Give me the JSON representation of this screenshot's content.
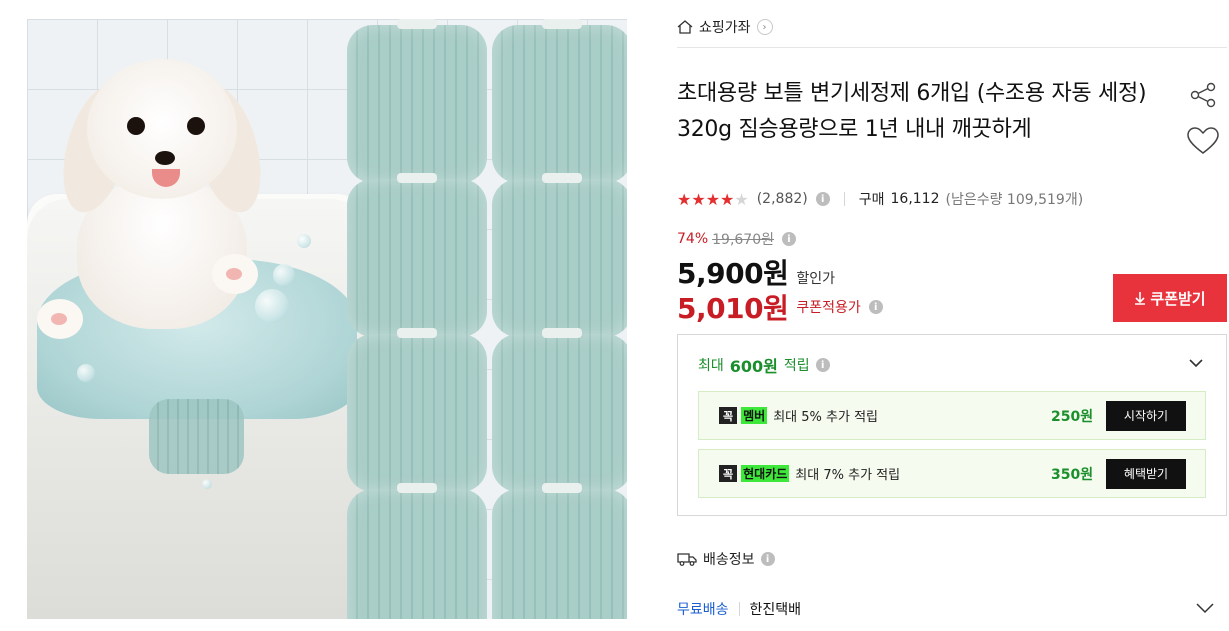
{
  "breadcrumb": {
    "label": "쇼핑가좌"
  },
  "product": {
    "title": "초대용량 보틀 변기세정제 6개입 (수조용 자동 세정) 320g 짐승용량으로 1년 내내 깨끗하게",
    "rating": {
      "stars": 4,
      "max": 5,
      "count_text": "(2,882)"
    },
    "purchases": {
      "label": "구매",
      "count": "16,112",
      "remaining": "(남은수량 109,519개)"
    },
    "discount_pct": "74%",
    "original_price": "19,670원",
    "sale_price": "5,900원",
    "sale_label": "할인가",
    "coupon_price": "5,010원",
    "coupon_label": "쿠폰적용가",
    "coupon_button": "쿠폰받기"
  },
  "rewards": {
    "head_prefix": "최대",
    "head_amount": "600원",
    "head_suffix": "적립",
    "items": [
      {
        "badge": "꼭",
        "highlight": "멤버",
        "desc": "최대 5% 추가 적립",
        "amount": "250원",
        "button": "시작하기"
      },
      {
        "badge": "꼭",
        "highlight": "현대카드",
        "desc": "최대 7% 추가 적립",
        "amount": "350원",
        "button": "혜택받기"
      }
    ]
  },
  "shipping": {
    "title": "배송정보",
    "type": "무료배송",
    "carrier": "한진택배"
  },
  "colors": {
    "accent_red": "#e8323c",
    "price_red": "#c81d25",
    "reward_green": "#1a8f2c",
    "link_blue": "#1a5fd0"
  },
  "icons": [
    "home-icon",
    "chevron-right-icon",
    "share-icon",
    "heart-icon",
    "info-icon",
    "download-icon",
    "chevron-down-icon",
    "truck-icon"
  ]
}
